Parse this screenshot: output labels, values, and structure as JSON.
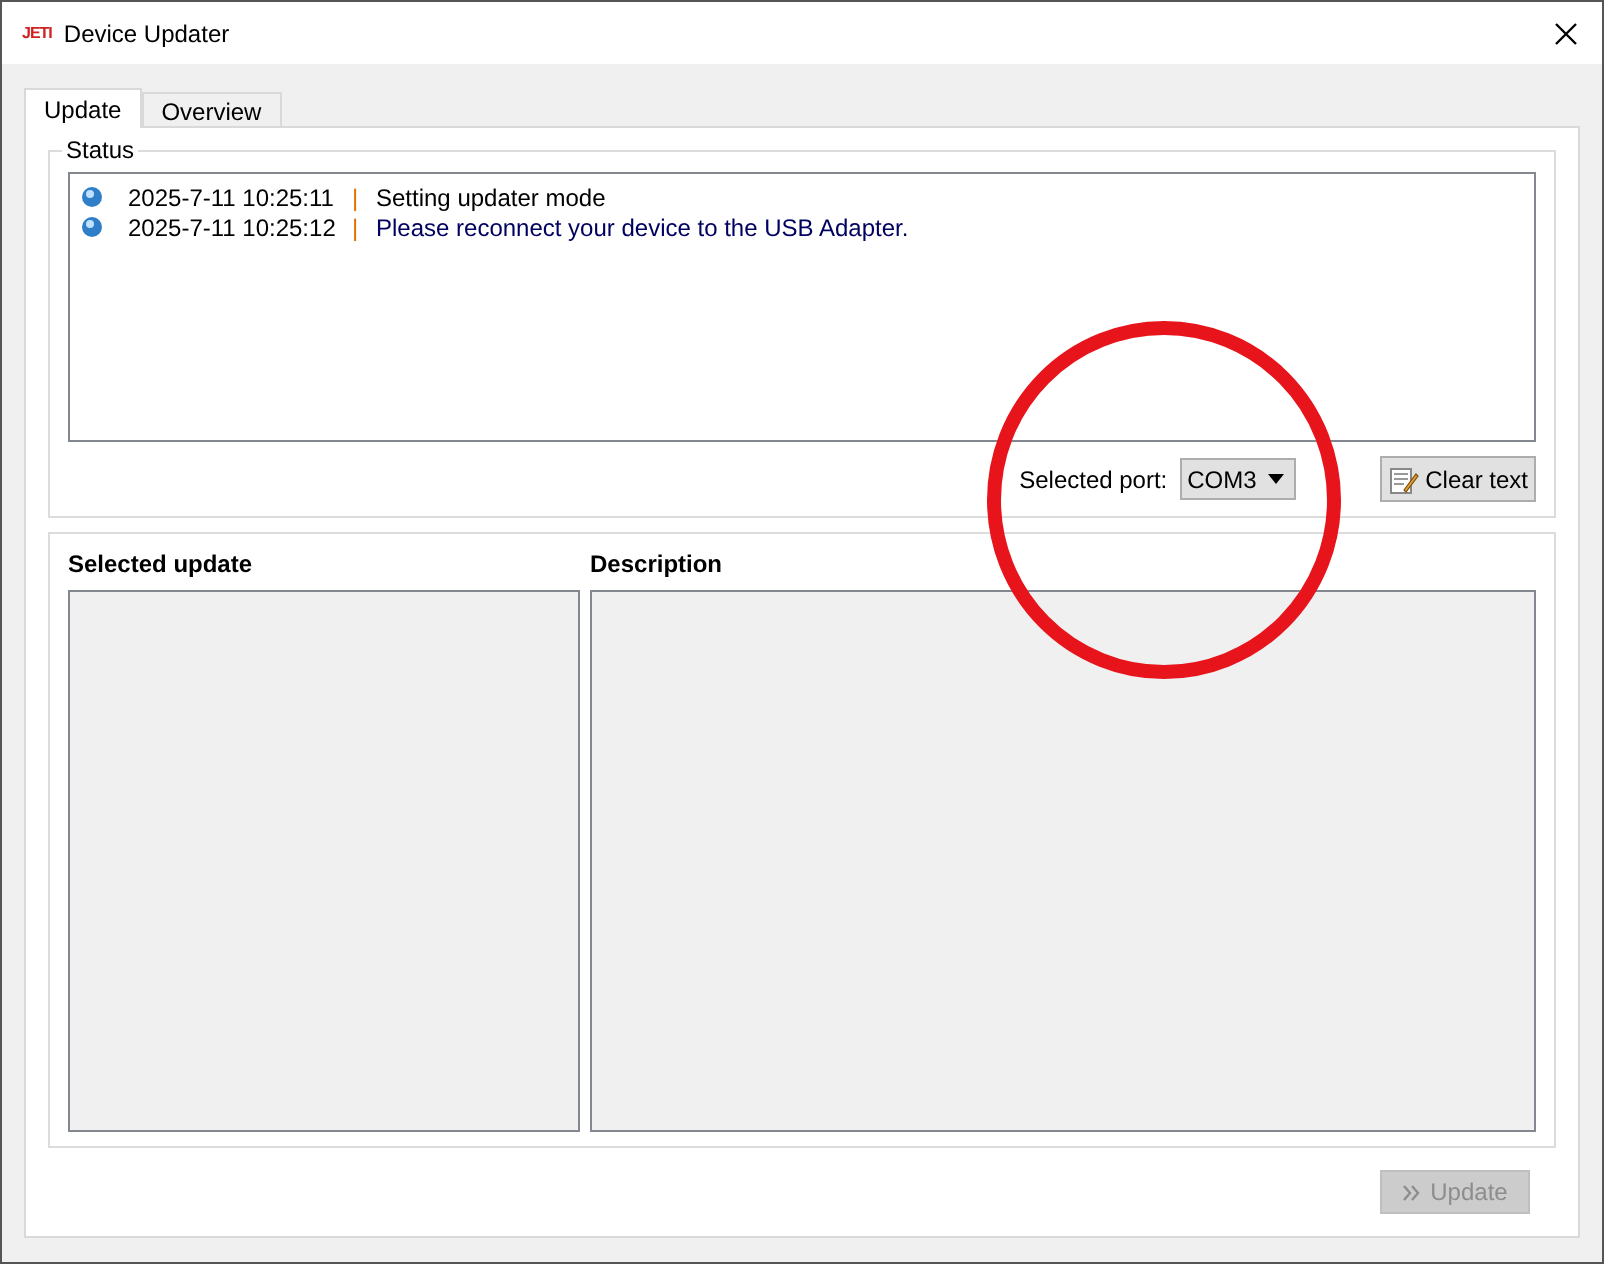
{
  "window": {
    "title": "Device Updater",
    "logo": "JETI"
  },
  "tabs": [
    {
      "label": "Update",
      "selected": true
    },
    {
      "label": "Overview",
      "selected": false
    }
  ],
  "status": {
    "title": "Status",
    "log": [
      {
        "time": "2025-7-11 10:25:11",
        "separator": "|",
        "message": "Setting updater mode"
      },
      {
        "time": "2025-7-11 10:25:12",
        "separator": "|",
        "message": "Please reconnect your device to the USB Adapter."
      }
    ],
    "port_label": "Selected port:",
    "port_value": "COM3",
    "clear_button": "Clear text"
  },
  "selected_update": {
    "title": "Selected update"
  },
  "description": {
    "title": "Description"
  },
  "update_button": {
    "label": "Update",
    "disabled": true
  }
}
